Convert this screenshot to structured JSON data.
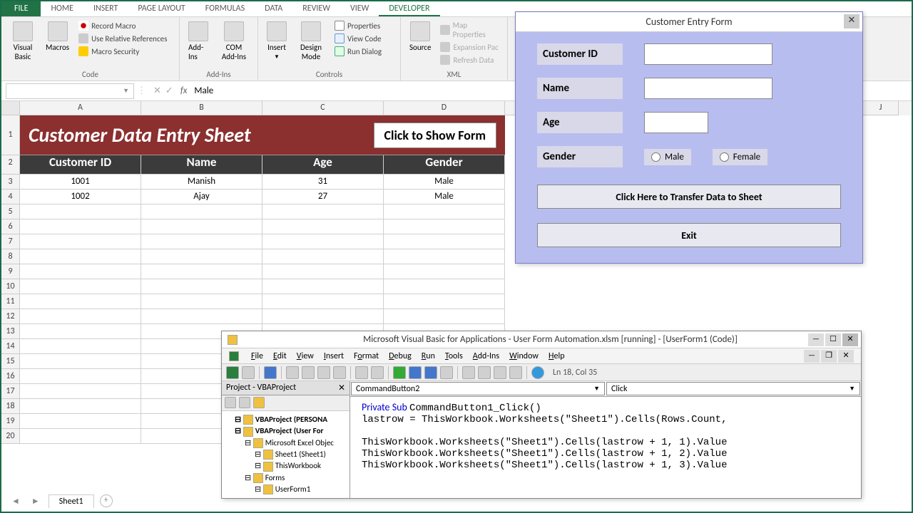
{
  "ribbon": {
    "file": "FILE",
    "tabs": [
      "HOME",
      "INSERT",
      "PAGE LAYOUT",
      "FORMULAS",
      "DATA",
      "REVIEW",
      "VIEW",
      "DEVELOPER"
    ],
    "active_tab": "DEVELOPER",
    "groups": {
      "code": {
        "label": "Code",
        "visual_basic": "Visual Basic",
        "macros": "Macros",
        "record": "Record Macro",
        "relative": "Use Relative References",
        "security": "Macro Security"
      },
      "addins": {
        "label": "Add-Ins",
        "addins": "Add-Ins",
        "com": "COM Add-Ins"
      },
      "controls": {
        "label": "Controls",
        "insert": "Insert",
        "design": "Design Mode",
        "properties": "Properties",
        "view_code": "View Code",
        "run_dialog": "Run Dialog"
      },
      "xml": {
        "label": "XML",
        "source": "Source",
        "map": "Map Properties",
        "expansion": "Expansion Pac",
        "refresh": "Refresh Data"
      }
    }
  },
  "formula_bar": {
    "name_box": "",
    "value": "Male",
    "fx": "fx"
  },
  "columns": [
    "A",
    "B",
    "C",
    "D",
    "",
    "J"
  ],
  "banner": {
    "title": "Customer Data Entry Sheet",
    "button": "Click to Show Form"
  },
  "table": {
    "headers": [
      "Customer ID",
      "Name",
      "Age",
      "Gender"
    ],
    "rows": [
      {
        "id": "1001",
        "name": "Manish",
        "age": "31",
        "gender": "Male"
      },
      {
        "id": "1002",
        "name": "Ajay",
        "age": "27",
        "gender": "Male"
      }
    ]
  },
  "row_nums": [
    "1",
    "2",
    "3",
    "4",
    "5",
    "6",
    "7",
    "8",
    "9",
    "10",
    "11",
    "12",
    "13",
    "14",
    "15",
    "16",
    "17",
    "18",
    "19",
    "20"
  ],
  "userform": {
    "title": "Customer Entry Form",
    "labels": {
      "id": "Customer ID",
      "name": "Name",
      "age": "Age",
      "gender": "Gender"
    },
    "radios": {
      "male": "Male",
      "female": "Female"
    },
    "transfer": "Click Here to Transfer Data to Sheet",
    "exit": "Exit"
  },
  "vba": {
    "title": "Microsoft Visual Basic for Applications - User Form Automation.xlsm [running] - [UserForm1 (Code)]",
    "menu": [
      "File",
      "Edit",
      "View",
      "Insert",
      "Format",
      "Debug",
      "Run",
      "Tools",
      "Add-Ins",
      "Window",
      "Help"
    ],
    "status": "Ln 18, Col 35",
    "project_title": "Project - VBAProject",
    "tree": [
      {
        "t": "VBAProject (PERSONA",
        "cls": "bold tree-indent1"
      },
      {
        "t": "VBAProject (User For",
        "cls": "bold tree-indent1"
      },
      {
        "t": "Microsoft Excel Objec",
        "cls": "tree-indent2"
      },
      {
        "t": "Sheet1 (Sheet1)",
        "cls": "tree-indent3"
      },
      {
        "t": "ThisWorkbook",
        "cls": "tree-indent3"
      },
      {
        "t": "Forms",
        "cls": "tree-indent2"
      },
      {
        "t": "UserForm1",
        "cls": "tree-indent3"
      }
    ],
    "select_left": "CommandButton2",
    "select_right": "Click",
    "code": [
      {
        "pre": "Private Sub ",
        "plain": "CommandButton1_Click()"
      },
      {
        "pre": "",
        "plain": "lastrow = ThisWorkbook.Worksheets(\"Sheet1\").Cells(Rows.Count,"
      },
      {
        "pre": "",
        "plain": ""
      },
      {
        "pre": "",
        "plain": "ThisWorkbook.Worksheets(\"Sheet1\").Cells(lastrow + 1, 1).Value"
      },
      {
        "pre": "",
        "plain": "ThisWorkbook.Worksheets(\"Sheet1\").Cells(lastrow + 1, 2).Value"
      },
      {
        "pre": "",
        "plain": "ThisWorkbook.Worksheets(\"Sheet1\").Cells(lastrow + 1, 3).Value"
      }
    ]
  },
  "sheet_tabs": {
    "active": "Sheet1"
  }
}
